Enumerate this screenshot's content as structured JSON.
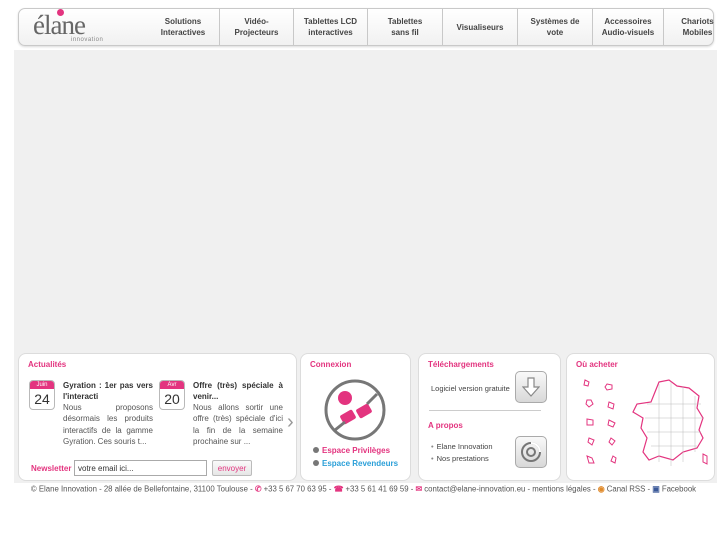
{
  "brand": {
    "logo_word": "élane",
    "logo_tag": "innovation"
  },
  "nav": [
    {
      "label": "Solutions\nInteractives"
    },
    {
      "label": "Vidéo-\nProjecteurs"
    },
    {
      "label": "Tablettes LCD\ninteractives"
    },
    {
      "label": "Tablettes\nsans fil"
    },
    {
      "label": "Visualiseurs"
    },
    {
      "label": "Systèmes de vote"
    },
    {
      "label": "Accessoires\nAudio-visuels"
    },
    {
      "label": "Chariots\nMobiles"
    }
  ],
  "news": {
    "title": "Actualités",
    "items": [
      {
        "month": "Juin",
        "day": "24",
        "title": "Gyration : 1er pas vers l'interacti",
        "text": "Nous proposons désormais les produits interactifs de la gamme Gyration. Ces souris t..."
      },
      {
        "month": "Avr",
        "day": "20",
        "title": "Offre (très) spéciale à venir...",
        "text": "Nous allons sortir une offre (très) spéciale d'ici la fin de la semaine prochaine sur ..."
      }
    ],
    "newsletter_label": "Newsletter",
    "newsletter_value": "votre email ici...",
    "newsletter_button": "envoyer"
  },
  "connexion": {
    "title": "Connexion",
    "links": [
      {
        "label": "Espace Privilèges",
        "color": "#e3347f"
      },
      {
        "label": "Espace Revendeurs",
        "color": "#2a9fd8"
      }
    ]
  },
  "downloads": {
    "title": "Téléchargements",
    "text": "Logiciel version gratuite"
  },
  "about": {
    "title": "A propos",
    "items": [
      "Elane Innovation",
      "Nos prestations"
    ]
  },
  "buy": {
    "title": "Où acheter"
  },
  "footer": {
    "address": "© Elane Innovation - 28 allée de Bellefontaine, 31100 Toulouse -",
    "phone": "+33 5 67 70 63 95 -",
    "fax": "+33 5 61 41 69 59 -",
    "email": "contact@elane-innovation.eu",
    "legal": "- mentions légales -",
    "rss": "Canal RSS -",
    "facebook": "Facebook"
  },
  "colors": {
    "accent": "#e3347f",
    "link_blue": "#2a9fd8",
    "panel_bg": "#f0f0f0"
  }
}
